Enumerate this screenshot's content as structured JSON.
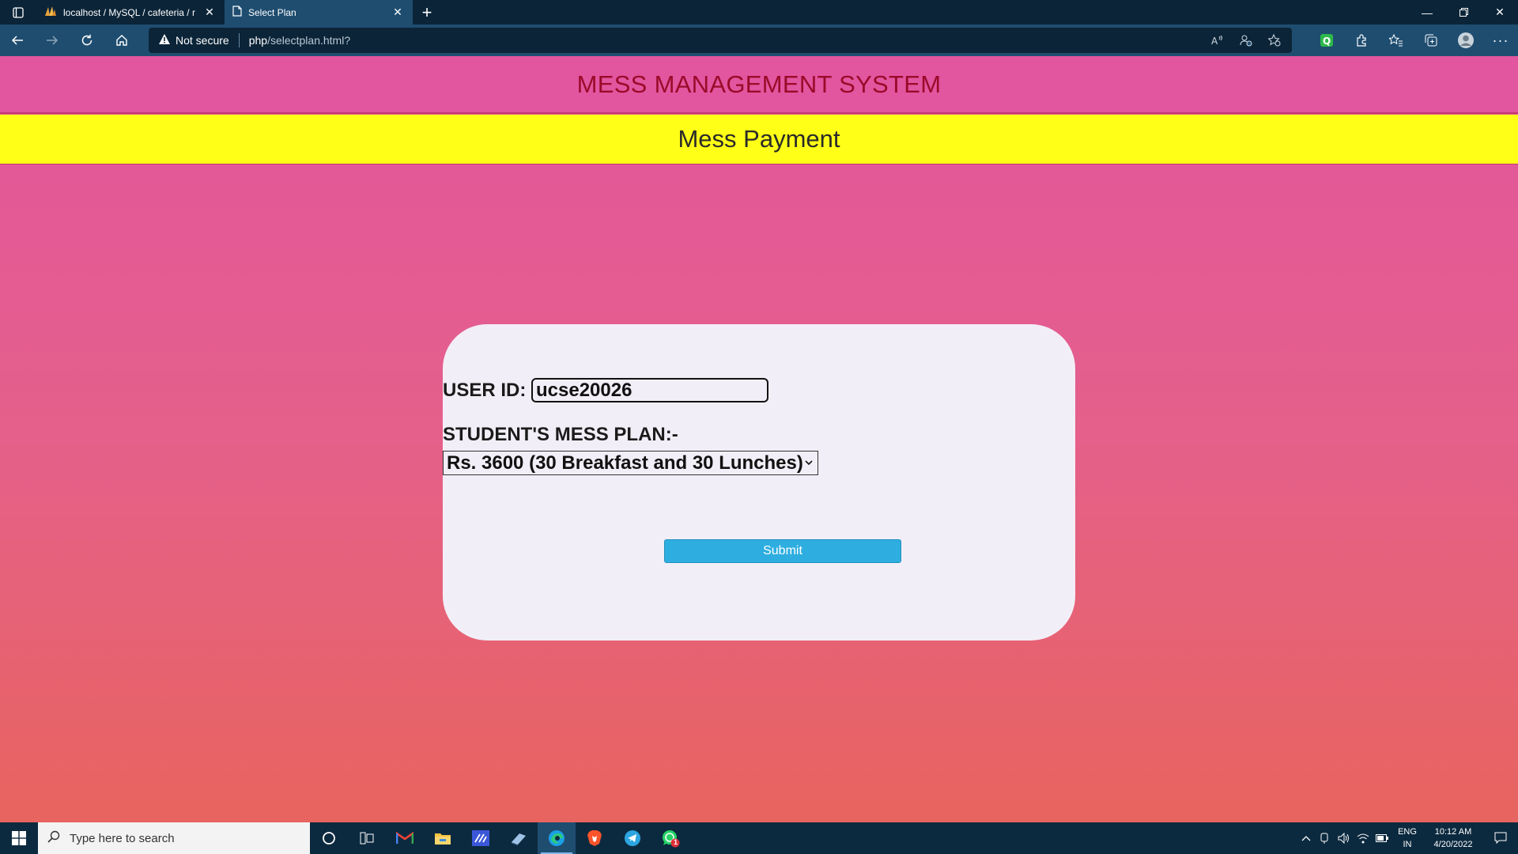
{
  "browser": {
    "tabs": [
      {
        "title": "localhost / MySQL / cafeteria / r",
        "icon": "phpmyadmin-icon",
        "active": false
      },
      {
        "title": "Select Plan",
        "icon": "page-icon",
        "active": true
      }
    ],
    "address": {
      "security_label": "Not secure",
      "url_host": "php",
      "url_path": "/selectplan.html?"
    }
  },
  "page": {
    "site_title": "MESS MANAGEMENT SYSTEM",
    "subtitle": "Mess Payment",
    "form": {
      "user_id_label": "USER ID:",
      "user_id_value": "ucse20026",
      "plan_label": "STUDENT'S MESS PLAN:-",
      "plan_selected": "Rs. 3600 (30 Breakfast and 30 Lunches)",
      "submit_label": "Submit"
    }
  },
  "taskbar": {
    "search_placeholder": "Type here to search",
    "lang_line1": "ENG",
    "lang_line2": "IN",
    "time": "10:12 AM",
    "date": "4/20/2022",
    "whatsapp_badge": "1"
  },
  "colors": {
    "header_bg": "#e2559f",
    "title_color": "#9a0b2a",
    "subheader_bg": "#ffff17",
    "submit_bg": "#2eaee0",
    "card_bg": "#f2eef7"
  }
}
